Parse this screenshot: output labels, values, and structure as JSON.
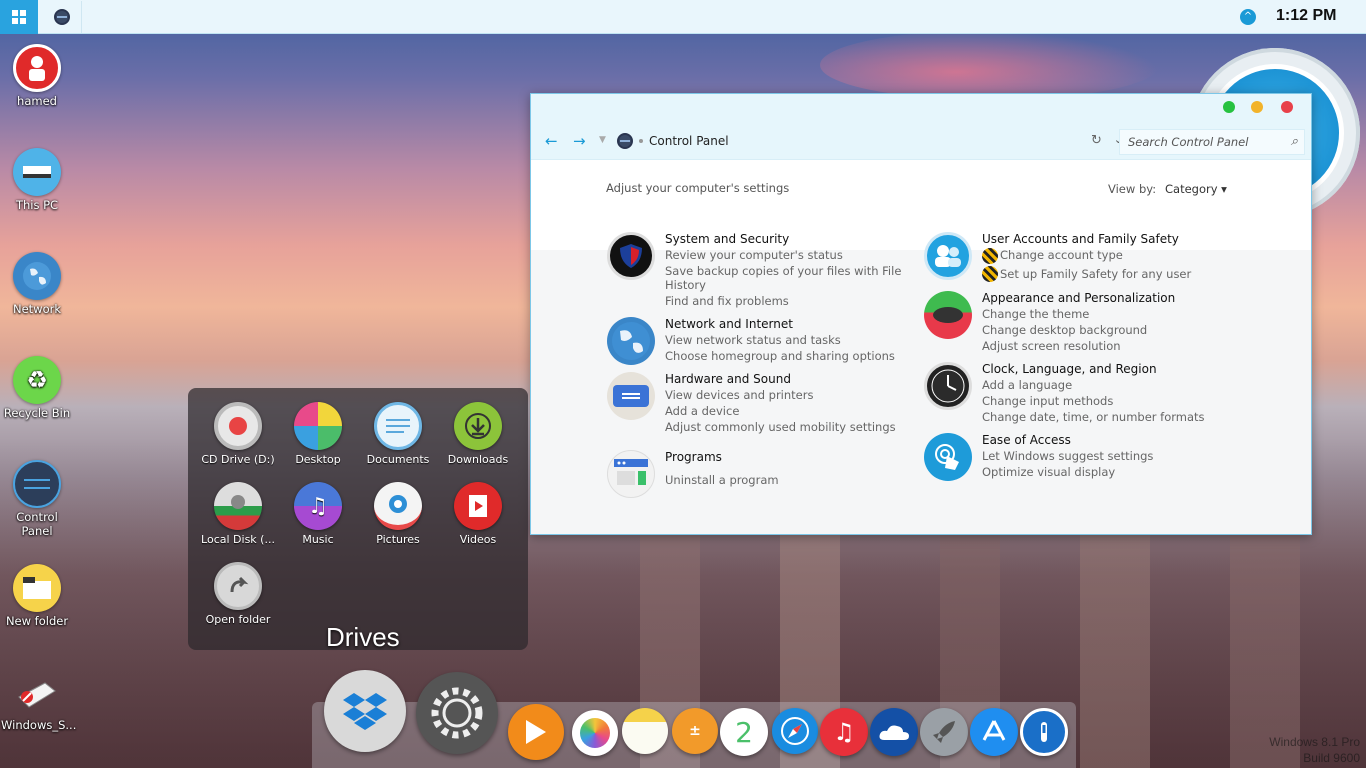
{
  "taskbar": {
    "time": "1:12 PM",
    "tray_up_glyph": "^"
  },
  "desktop_icons": [
    {
      "label": "hamed",
      "icon": "user-icon"
    },
    {
      "label": "This PC",
      "icon": "computer-icon"
    },
    {
      "label": "Network",
      "icon": "globe-icon"
    },
    {
      "label": "Recycle Bin",
      "icon": "recycle-icon"
    },
    {
      "label": "Control Panel",
      "icon": "control-panel-icon"
    },
    {
      "label": "New folder",
      "icon": "folder-icon"
    },
    {
      "label": "Windows_S...",
      "icon": "file-icon"
    }
  ],
  "control_panel": {
    "address": "Control Panel",
    "search_placeholder": "Search Control Panel",
    "adjust_text": "Adjust your computer's settings",
    "view_by_label": "View by:",
    "view_by_value": "Category",
    "categories_left": [
      {
        "title": "System and Security",
        "links": [
          "Review your computer's status",
          "Save backup copies of your files with File",
          "History",
          "Find and fix problems"
        ]
      },
      {
        "title": "Network and Internet",
        "links": [
          "View network status and tasks",
          "Choose homegroup and sharing options"
        ]
      },
      {
        "title": "Hardware and Sound",
        "links": [
          "View devices and printers",
          "Add a device",
          "Adjust commonly used mobility settings"
        ]
      },
      {
        "title": "Programs",
        "links": [
          "Uninstall a program"
        ]
      }
    ],
    "categories_right": [
      {
        "title": "User Accounts and Family Safety",
        "links": [
          "Change account type",
          "Set up Family Safety for any user"
        ]
      },
      {
        "title": "Appearance and Personalization",
        "links": [
          "Change the theme",
          "Change desktop background",
          "Adjust screen resolution"
        ]
      },
      {
        "title": "Clock, Language, and Region",
        "links": [
          "Add a language",
          "Change input methods",
          "Change date, time, or number formats"
        ]
      },
      {
        "title": "Ease of Access",
        "links": [
          "Let Windows suggest settings",
          "Optimize visual display"
        ]
      }
    ]
  },
  "drives_stack": {
    "title": "Drives",
    "items": [
      "CD Drive (D:)",
      "Desktop",
      "Documents",
      "Downloads",
      "Local Disk (...",
      "Music",
      "Pictures",
      "Videos",
      "Open folder"
    ]
  },
  "dock_icons": [
    "dropbox-icon",
    "settings-icon",
    "media-player-icon",
    "photos-icon",
    "notes-icon",
    "calculator-icon",
    "facetime-icon",
    "safari-icon",
    "music-icon",
    "onedrive-icon",
    "rocket-icon",
    "app-store-icon",
    "1password-icon"
  ],
  "watermark": {
    "line1": "Windows 8.1 Pro",
    "line2": "Build 9600"
  },
  "colors": {
    "accent": "#29a3df",
    "close": "#e8414a",
    "minimize": "#f2b32a",
    "maximize": "#27c240"
  }
}
